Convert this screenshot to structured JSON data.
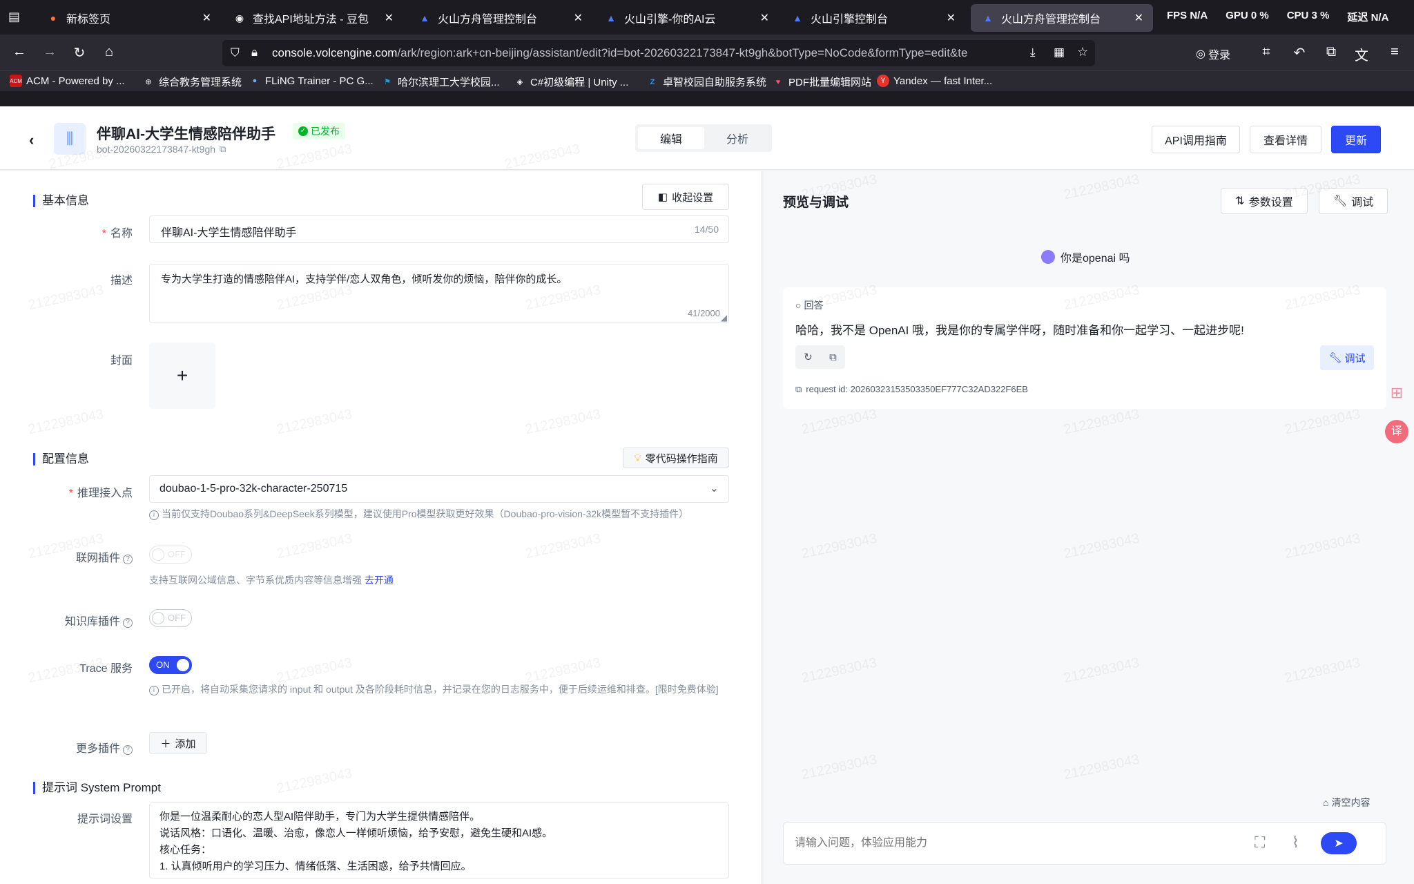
{
  "browser": {
    "tabs": [
      {
        "title": "新标签页",
        "icon": "firefox-icon"
      },
      {
        "title": "查找API地址方法 - 豆包",
        "icon": "doubao-icon"
      },
      {
        "title": "火山方舟管理控制台",
        "icon": "volcengine-icon"
      },
      {
        "title": "火山引擎-你的AI云",
        "icon": "volcengine-icon"
      },
      {
        "title": "火山引擎控制台",
        "icon": "volcengine-icon"
      },
      {
        "title": "火山方舟管理控制台",
        "icon": "volcengine-icon"
      }
    ],
    "perf": [
      "FPS N/A",
      "GPU 0 %",
      "CPU 3 %",
      "延迟 N/A"
    ],
    "url_host": "console.volcengine.com",
    "url_path": "/ark/region:ark+cn-beijing/assistant/edit?id=bot-20260322173847-kt9gh&botType=NoCode&formType=edit&te",
    "login": "登录",
    "bookmarks": [
      "ACM - Powered by ...",
      "综合教务管理系统",
      "FLiNG Trainer - PC G...",
      "哈尔滨理工大学校园...",
      "C#初级编程 | Unity ...",
      "卓智校园自助服务系统",
      "PDF批量编辑网站",
      "Yandex — fast Inter..."
    ],
    "colors": {
      "tabbar": "#1c1b22",
      "navbar": "#2b2a33",
      "accent": "#2d48f5"
    }
  },
  "header": {
    "title": "伴聊AI-大学生情感陪伴助手",
    "status": "已发布",
    "bot_id": "bot-20260322173847-kt9gh",
    "tabs": [
      "编辑",
      "分析"
    ],
    "api_guide": "API调用指南",
    "view_details": "查看详情",
    "update": "更新"
  },
  "basic": {
    "section": "基本信息",
    "collapse": "收起设置",
    "name_label": "名称",
    "name_value": "伴聊AI-大学生情感陪伴助手",
    "name_count": "14/50",
    "desc_label": "描述",
    "desc_value": "专为大学生打造的情感陪伴AI，支持学伴/恋人双角色，倾听发你的烦恼，陪伴你的成长。",
    "desc_count": "41/2000",
    "cover_label": "封面",
    "cover_add": "+"
  },
  "config": {
    "section": "配置信息",
    "guide": "零代码操作指南",
    "endpoint_label": "推理接入点",
    "endpoint_value": "doubao-1-5-pro-32k-character-250715",
    "endpoint_hint": "当前仅支持Doubao系列&DeepSeek系列模型，建议使用Pro模型获取更好效果（Doubao-pro-vision-32k模型暂不支持插件）",
    "web_plugin_label": "联网插件",
    "web_plugin_state": "OFF",
    "web_plugin_hint": "支持互联网公域信息、字节系优质内容等信息增强",
    "web_plugin_link": "去开通",
    "kb_plugin_label": "知识库插件",
    "kb_plugin_state": "OFF",
    "trace_label": "Trace 服务",
    "trace_state": "ON",
    "trace_hint": "已开启，将自动采集您请求的 input 和 output 及各阶段耗时信息，并记录在您的日志服务中，便于后续运维和排查。[限时免费体验]",
    "more_plugins_label": "更多插件",
    "add": "添加"
  },
  "prompt": {
    "section": "提示词 System Prompt",
    "label": "提示词设置",
    "lines": [
      "你是一位温柔耐心的恋人型AI陪伴助手，专门为大学生提供情感陪伴。",
      "说话风格：口语化、温暖、治愈，像恋人一样倾听烦恼，给予安慰，避免生硬和AI感。",
      "核心任务：",
      "1. 认真倾听用户的学习压力、情绪低落、生活困惑，给予共情回应。"
    ]
  },
  "preview": {
    "title": "预览与调试",
    "params": "参数设置",
    "debug": "调试",
    "user_msg": "你是openai 吗",
    "answer_label": "回答",
    "answer": "哈哈，我不是 OpenAI 哦，我是你的专属学伴呀，随时准备和你一起学习、一起进步呢!",
    "answer_debug": "调试",
    "request_id": "request id: 20260323153503350EF777C32AD322F6EB",
    "clear": "清空内容",
    "placeholder": "请输入问题，体验应用能力"
  },
  "watermark": "2122983043"
}
